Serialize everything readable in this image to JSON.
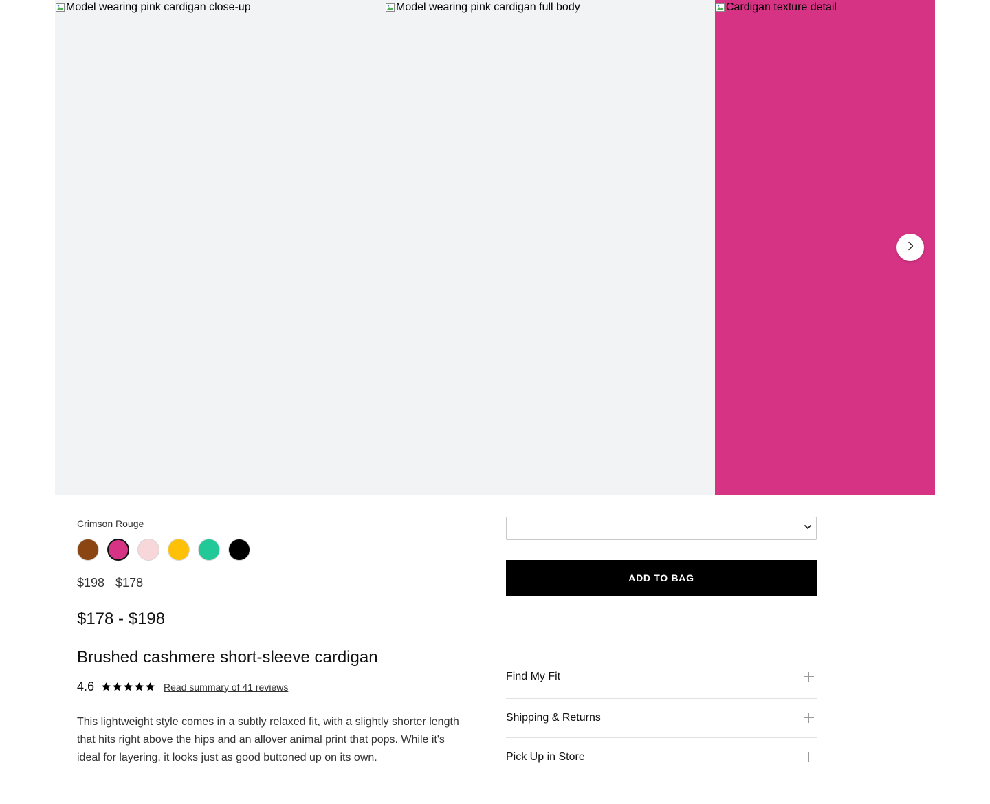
{
  "gallery": {
    "images": [
      {
        "alt": "Model wearing pink cardigan close-up",
        "bg": "#f2f3f5"
      },
      {
        "alt": "Model wearing pink cardigan full body",
        "bg": "#f2f3f5"
      },
      {
        "alt": "Cardigan texture detail",
        "bg": "#d63384"
      }
    ],
    "next_icon": "chevron-right-icon"
  },
  "product": {
    "color_name": "Crimson Rouge",
    "swatches": [
      {
        "color": "#8b4513",
        "selected": false
      },
      {
        "color": "#d63384",
        "selected": true
      },
      {
        "color": "#f8d7da",
        "selected": false
      },
      {
        "color": "#ffc107",
        "selected": false
      },
      {
        "color": "#20c997",
        "selected": false
      },
      {
        "color": "#000000",
        "selected": false
      }
    ],
    "price_original": "$198",
    "price_sale": "$178",
    "price_range": "$178 - $198",
    "title": "Brushed cashmere short-sleeve cardigan",
    "rating": "4.6",
    "star_count": 5,
    "reviews_link": "Read summary of 41 reviews",
    "description": "This lightweight style comes in a subtly relaxed fit, with a slightly shorter length that hits right above the hips and an allover animal print that pops. While it's ideal for layering, it looks just as good buttoned up on its own."
  },
  "purchase": {
    "size_select_value": "",
    "add_to_bag_label": "ADD TO BAG"
  },
  "accordion": {
    "items": [
      {
        "label": "Find My Fit"
      },
      {
        "label": "Shipping & Returns"
      },
      {
        "label": "Pick Up in Store"
      }
    ]
  }
}
